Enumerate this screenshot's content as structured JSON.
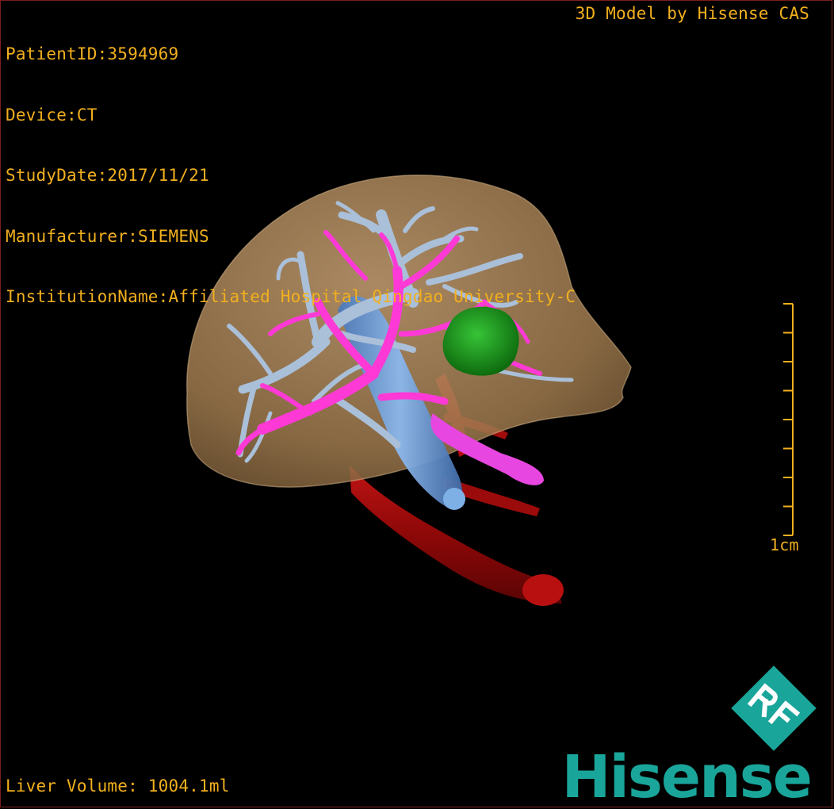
{
  "patient_info": [
    "PatientID:3594969",
    "Device:CT",
    "StudyDate:2017/11/21",
    "Manufacturer:SIEMENS",
    "InstitutionName:Affiliated Hospital Qingdao University-C"
  ],
  "brand_caption": "3D Model by Hisense CAS",
  "liver_volume": "Liver Volume: 1004.1ml",
  "scale_bar": {
    "label": "1cm",
    "ticks": 9
  },
  "logo": {
    "monogram": "RF",
    "wordmark": "Hisense"
  },
  "colors": {
    "overlay_text": "#f2b01e",
    "liver": "#b08a5c",
    "hepatic_vein": "#aabfd8",
    "portal_vein": "#ff39d6",
    "artery_ivc": "#a80c0c",
    "ivc_blue": "#5f96d4",
    "tumor": "#1a9a1a",
    "pancreas_duct": "#e040e0",
    "logo_teal": "#1aa59a"
  },
  "icons": [
    "hisense-rf-logo-icon",
    "scale-bar-icon"
  ]
}
